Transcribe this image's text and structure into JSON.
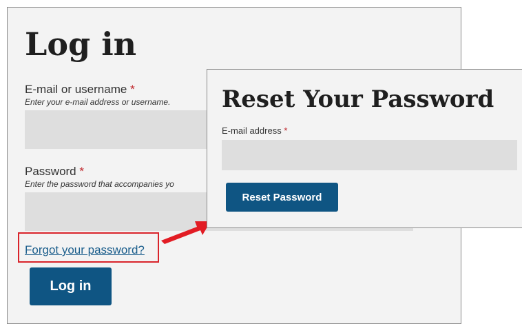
{
  "login": {
    "title": "Log in",
    "username_label": "E-mail or username",
    "username_required": "*",
    "username_hint": "Enter your e-mail address or username.",
    "username_value": "",
    "password_label": "Password",
    "password_required": "*",
    "password_hint": "Enter the password that accompanies yo",
    "password_value": "",
    "forgot_link": "Forgot your password?",
    "submit_label": "Log in"
  },
  "reset": {
    "title": "Reset Your Password",
    "email_label": "E-mail address",
    "email_required": "*",
    "email_value": "",
    "submit_label": "Reset Password"
  },
  "colors": {
    "button": "#0f5583",
    "required": "#c0282d",
    "highlight": "#d9232a",
    "link": "#1b5e8c",
    "panel_bg": "#f3f3f3",
    "input_bg": "#dedede"
  },
  "annotations": {
    "highlight_box": "red-rectangle",
    "arrow": "red-arrow-icon"
  }
}
